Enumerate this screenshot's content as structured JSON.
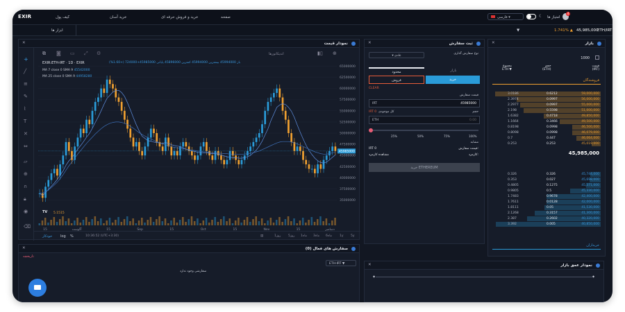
{
  "topbar": {
    "logo": "EXIR",
    "nav": [
      "کیف پول",
      "خرید آسان",
      "خرید و فروش حرفه ای",
      "صفحه"
    ],
    "lang": "فارسی",
    "user": "امتیاز ها",
    "notif": "4"
  },
  "subbar": {
    "tools": "ابزار ها",
    "pair": "ETH/IRT",
    "price": "45,985,000",
    "change": "1.741% ▲"
  },
  "chart": {
    "title": "نمودار قیمت",
    "symbol": "EXIR:ETH-IRT",
    "interval": "1D",
    "source": "EXIR",
    "ohlc": "باز 45994000 بیشترین 45994000 کمترین 45896000 پایانی 45985000+724000 (+1.60%)",
    "ma7": "MA 7 close 0 SMA 9",
    "ma7v": "45542000",
    "ma25": "MA 25 close 0 SMA 9",
    "ma25v": "44958280",
    "volume": "5.1515",
    "indicators": "اندیکاتورها",
    "time": "10:36:52 (UTC+3:30)",
    "auto": "خودکار",
    "log": "log",
    "pct": "%",
    "ranges": [
      "5y",
      "1y",
      "6ماه",
      "3ماه",
      "1ماه",
      "5روز",
      "1روز"
    ]
  },
  "chart_data": {
    "type": "candlestick",
    "title": "",
    "yticks": [
      "65000000",
      "62500000",
      "60000000",
      "57500000",
      "55000000",
      "52500000",
      "50000000",
      "47500000",
      "45000000",
      "42500000",
      "40000000",
      "37500000",
      "35000000"
    ],
    "xticks": [
      "15",
      "آگوست",
      "15",
      "Sep",
      "15",
      "Oct",
      "15",
      "Nov",
      "15",
      "دسامبر"
    ],
    "last_price": "45985000",
    "ylim": [
      34000000,
      66000000
    ],
    "close": [
      36.5,
      35.5,
      38,
      39.5,
      41,
      42,
      40.5,
      43,
      45,
      48,
      46,
      44,
      47,
      49,
      51,
      50,
      53,
      52,
      55,
      57,
      58,
      60,
      59,
      62,
      61,
      60,
      58,
      57,
      55,
      53,
      51,
      49,
      47,
      48,
      46,
      45,
      47,
      49,
      51,
      50,
      48,
      47,
      46,
      49,
      47,
      45,
      46,
      45,
      47,
      48,
      47,
      46,
      45,
      44,
      45,
      47,
      48,
      46,
      45,
      44,
      46,
      45,
      44,
      43,
      44,
      46,
      45,
      44,
      43,
      44,
      45,
      46,
      47,
      48,
      49,
      50,
      52,
      55,
      57,
      58,
      59,
      60,
      58,
      55,
      53,
      50,
      48,
      46,
      47,
      46,
      44,
      43,
      42,
      42,
      41,
      43,
      42,
      44,
      45,
      46,
      47,
      46
    ],
    "ma7": [
      36.5,
      36,
      36.7,
      37.4,
      38.1,
      38.8,
      39.6,
      40.6,
      41.5,
      42.8,
      43.8,
      44.5,
      45.4,
      46.4,
      47.2,
      48.1,
      49.1,
      49.9,
      51.1,
      52.4,
      53.6,
      55,
      56.5,
      57.8,
      58.5,
      59.2,
      59.5,
      59.6,
      59.1,
      58.2,
      56.8,
      55.2,
      53.5,
      51.9,
      50.5,
      49.3,
      48.8,
      48.3,
      48.2,
      48,
      47.9,
      47.8,
      47.7,
      47.9,
      47.7,
      47.4,
      47.2,
      47.1,
      47,
      46.7,
      46.4,
      46.2,
      46,
      45.9,
      45.7,
      45.6,
      45.6,
      45.6,
      45.5,
      45.4,
      45.4,
      45.3,
      45.1,
      44.9,
      44.7,
      44.6,
      44.5,
      44.5,
      44.4,
      44.4,
      44.5,
      44.7,
      45,
      45.6,
      46.2,
      47.1,
      48.2,
      49.6,
      51,
      52.8,
      54.3,
      55.8,
      56.3,
      56.6,
      56.4,
      55.8,
      54.9,
      53.5,
      51.8,
      50.2,
      48.7,
      47.3,
      46.1,
      45.2,
      44.4,
      43.8,
      43.4,
      43.3,
      43.5,
      44,
      44.6,
      45.1
    ],
    "ma25": [
      36.5,
      36.6,
      36.9,
      37.3,
      37.8,
      38.4,
      39,
      39.8,
      40.7,
      41.7,
      42.7,
      43.5,
      44.4,
      45.3,
      46.1,
      46.9,
      47.7,
      48.4,
      49.1,
      49.8,
      50.4,
      51,
      51.5,
      51.9,
      52.2,
      52.4,
      52.5,
      52.5,
      52.4,
      52.2,
      51.9,
      51.5,
      51.1,
      50.6,
      50.1,
      49.7,
      49.3,
      49,
      48.7,
      48.4,
      48.1,
      47.8,
      47.6,
      47.4,
      47.2,
      47,
      46.8,
      46.7,
      46.6,
      46.5,
      46.4,
      46.3,
      46.2,
      46.1,
      46,
      45.9,
      45.8,
      45.8,
      45.7,
      45.6,
      45.6,
      45.5,
      45.5,
      45.4,
      45.4,
      45.3,
      45.3,
      45.3,
      45.3,
      45.3,
      45.3,
      45.4,
      45.5,
      45.6,
      45.8,
      46,
      46.3,
      46.6,
      46.9,
      47.2,
      47.5,
      47.8,
      48,
      48.1,
      48.1,
      48.1,
      48,
      47.8,
      47.6,
      47.3,
      47,
      46.7,
      46.4,
      46.1,
      45.8,
      45.6,
      45.4,
      45.3,
      45.3,
      45.4,
      45.6,
      45.7
    ]
  },
  "order": {
    "title": "ثبت سفارش",
    "type_label": "نوع سفارش گذاری",
    "type_value": "عادی",
    "tab_market": "بازار",
    "tab_limit": "محدود",
    "buy": "خرید",
    "sell": "فروش",
    "clear": "CLEAR",
    "amount_label": "قیمت سفارش",
    "price_value": "45985000",
    "price_unit": "IRT",
    "balance_label": "کل موجودی",
    "balance_value": "IRT 0",
    "size_label": "حجم",
    "size_unit": "ETH",
    "size_value": "0.00",
    "marks": [
      "25%",
      "50%",
      "75%",
      "100%"
    ],
    "fee_label": "مشابه",
    "fee_value": "IRT 0",
    "total_label": "قیمت سفارش:",
    "fees": "کارمزد:",
    "view_fees": "مشاهده کارمزد",
    "submit": "خرید ETHEREUM"
  },
  "book": {
    "title": "بازار",
    "depth": "1000",
    "col_price": "قیمت",
    "col_price_u": "(IRT)",
    "col_vol": "حجم",
    "col_vol_u": "(ETH)",
    "col_total": "مجموع",
    "col_total_u": "ETH ▼",
    "sellers": "فروشندگان",
    "buyers": "خریداران",
    "mid": "45,985,000",
    "asks": [
      [
        "59,000,000",
        "0.6212",
        "3.0186"
      ],
      [
        "56,000,000",
        "0.0997",
        "2.3974"
      ],
      [
        "55,000,000",
        "0.0997",
        "2.2977"
      ],
      [
        "51,000,000",
        "0.5598",
        "2.198"
      ],
      [
        "49,850,000",
        "0.4718",
        "1.6382"
      ],
      [
        "49,500,000",
        "0.3466",
        "1.1664"
      ],
      [
        "46,500,000",
        "0.0998",
        "0.8198"
      ],
      [
        "46,079,000",
        "0.0998",
        "0.8098"
      ],
      [
        "46,064,000",
        "0.447",
        "0.7"
      ],
      [
        "45,019,000",
        "0.253",
        "0.253"
      ]
    ],
    "bids": [
      [
        "45,744,000",
        "0.326",
        "0.326"
      ],
      [
        "45,698,000",
        "0.027",
        "0.353"
      ],
      [
        "45,371,000",
        "0.1275",
        "0.4805"
      ],
      [
        "45,330,000",
        "0.5",
        "0.9805"
      ],
      [
        "42,400,000",
        "0.9678",
        "1.7483"
      ],
      [
        "42,000,000",
        "0.0128",
        "1.7611"
      ],
      [
        "41,530,000",
        "0.05",
        "1.8111"
      ],
      [
        "41,300,000",
        "0.3157",
        "2.1268"
      ],
      [
        "40,320,000",
        "0.2602",
        "2.387"
      ],
      [
        "40,850,000",
        "0.005",
        "3.392"
      ]
    ]
  },
  "open_orders": {
    "title": "سفارش های فعال (0)",
    "history": "تاریخچه",
    "pair": "ETH-IRT ▼",
    "empty": "سفارشی وجود ندارد"
  },
  "depth": {
    "title": "نمودار عمق بازار"
  }
}
